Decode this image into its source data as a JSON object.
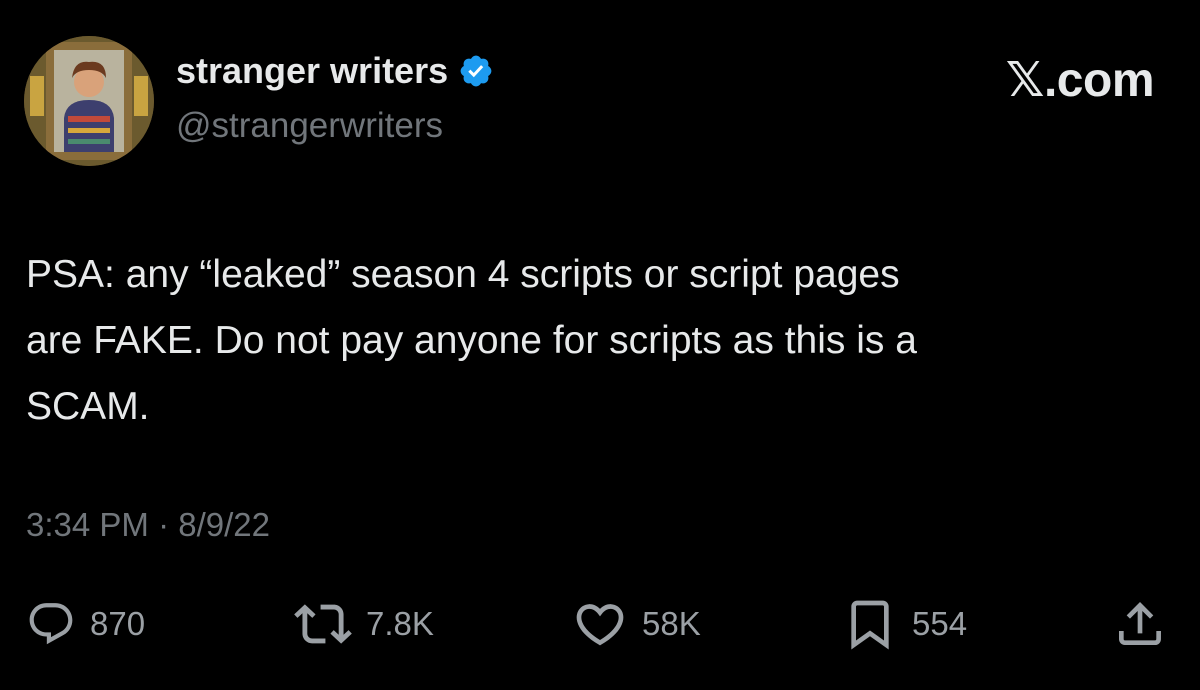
{
  "tweet": {
    "author": {
      "display_name": "stranger writers",
      "handle": "@strangerwriters",
      "verified": true,
      "avatar_icon": "portrait-avatar-icon"
    },
    "brand": "𝕏.com",
    "text": "PSA: any “leaked” season 4 scripts or script pages\nare FAKE. Do not pay anyone for scripts as this is a\nSCAM.",
    "timestamp": "3:34 PM · 8/9/22",
    "actions": {
      "replies": {
        "icon": "reply-icon",
        "count": "870"
      },
      "reposts": {
        "icon": "repost-icon",
        "count": "7.8K"
      },
      "likes": {
        "icon": "like-icon",
        "count": "58K"
      },
      "bookmarks": {
        "icon": "bookmark-icon",
        "count": "554"
      },
      "share": {
        "icon": "share-icon"
      }
    }
  },
  "colors": {
    "background": "#000000",
    "primary_text": "#e7e9ea",
    "secondary_text": "#71767b",
    "verified_badge": "#1d9bf0"
  }
}
